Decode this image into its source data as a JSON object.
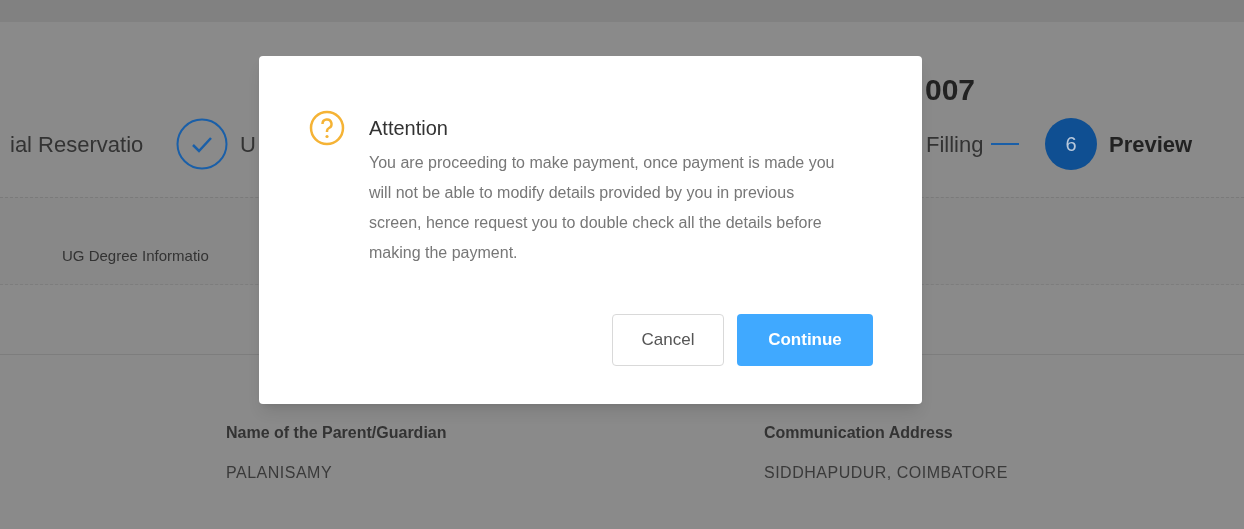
{
  "header": {
    "title": "007"
  },
  "steps": [
    {
      "label": "ial Reservatio",
      "kind": "plain"
    },
    {
      "label": "U",
      "kind": "done"
    },
    {
      "label": "Filling",
      "kind": "plain"
    },
    {
      "label": "Preview",
      "kind": "current",
      "number": "6"
    }
  ],
  "tabs": [
    {
      "label": "UG Degree Informatio"
    }
  ],
  "details": [
    {
      "label": "Name of the Parent/Guardian",
      "value": "PALANISAMY"
    },
    {
      "label": "Communication Address",
      "value": "SIDDHAPUDUR, COIMBATORE"
    }
  ],
  "dialog": {
    "title": "Attention",
    "message": "You are proceeding to make payment, once payment is made you will not be able to modify details provided by you in previous screen, hence request you to double check all the details before making the payment.",
    "buttons": [
      {
        "label": "Cancel",
        "kind": "secondary"
      },
      {
        "label": "Continue",
        "kind": "primary"
      }
    ]
  }
}
